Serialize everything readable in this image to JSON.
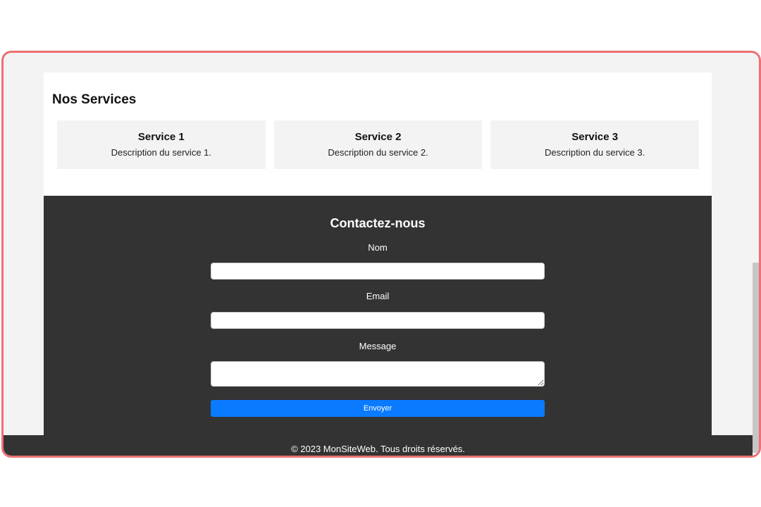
{
  "services": {
    "title": "Nos Services",
    "items": [
      {
        "title": "Service 1",
        "description": "Description du service 1."
      },
      {
        "title": "Service 2",
        "description": "Description du service 2."
      },
      {
        "title": "Service 3",
        "description": "Description du service 3."
      }
    ]
  },
  "contact": {
    "title": "Contactez-nous",
    "name_label": "Nom",
    "name_value": "",
    "email_label": "Email",
    "email_value": "",
    "message_label": "Message",
    "message_value": "",
    "submit_label": "Envoyer"
  },
  "footer": {
    "text": "© 2023 MonSiteWeb. Tous droits réservés."
  },
  "colors": {
    "frame_border": "#ee7072",
    "contact_background": "#333333",
    "button_accent": "#0a7bff",
    "page_background": "#f3f3f3"
  }
}
